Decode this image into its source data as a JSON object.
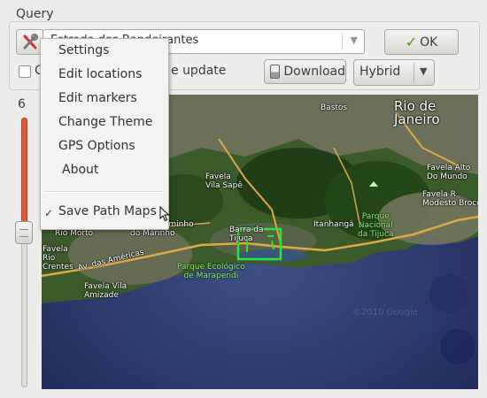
{
  "query": {
    "title": "Query",
    "search_value": "Estrada dos Bandeirantes",
    "ok_label": "OK",
    "checkbox_label": "C",
    "checkbox_label_rest": "e update",
    "download_label": "Download",
    "map_type": "Hybrid"
  },
  "zoom": {
    "level": "6"
  },
  "menu": {
    "items": [
      "Settings",
      "Edit locations",
      "Edit markers",
      "Change Theme",
      "GPS Options",
      "About"
    ],
    "check_item": "Save Path Maps",
    "check_mark": "✓"
  },
  "map": {
    "labels": {
      "bastos": "Bastos",
      "rio": "Rio de\nJaneiro",
      "favela_vila_sape": "Favela\nVila Sapê",
      "favela_alto_do_mundo": "Favela Alto\nDo Mundo",
      "favela_r_modesto_brocos": "Favela R\nModesto Brocos",
      "parque_tijuca": "Parque\nNacional\nda Tijuca",
      "itanhanga": "Itanhangá",
      "favela_caminho_marinho": "Favela Caminho\ndo Marinho",
      "favela_rio_morto": "Favela\nRio Morto",
      "barra_tijuca": "Barra da\nTijuca",
      "favela_rio_das_pedras": "Favela\nRio\nCrentes",
      "favela_vila_amizade": "Favela Vila\nAmizade",
      "parque_ecologico": "Parque Ecológico\nde Marapendi",
      "av_das_americas": "Av. das Américas"
    },
    "copyright": "©2010 Google"
  },
  "colors": {
    "accent_green": "#4e9a06",
    "slider_fill": "#e05a3a",
    "marker": "#2ee52e"
  }
}
